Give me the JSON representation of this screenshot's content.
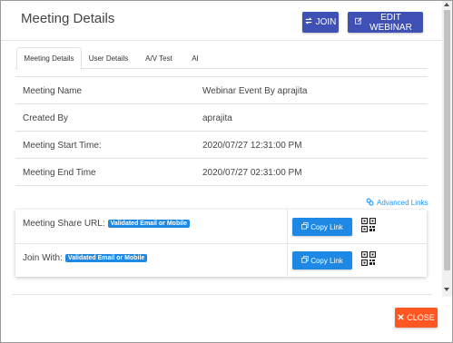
{
  "header": {
    "title": "Meeting Details",
    "join_label": "JOIN",
    "edit_label": "EDIT WEBINAR"
  },
  "tabs": [
    {
      "label": "Meeting Details",
      "active": true
    },
    {
      "label": "User Details",
      "active": false
    },
    {
      "label": "A/V Test",
      "active": false
    },
    {
      "label": "AI",
      "active": false
    }
  ],
  "details": [
    {
      "label": "Meeting Name",
      "value": "Webinar Event By aprajita"
    },
    {
      "label": "Created By",
      "value": "aprajita"
    },
    {
      "label": "Meeting Start Time:",
      "value": "2020/07/27 12:31:00 PM"
    },
    {
      "label": "Meeting End Time",
      "value": "2020/07/27 02:31:00 PM"
    }
  ],
  "advanced_links_label": "Advanced Links",
  "share": [
    {
      "label": "Meeting Share URL:",
      "badge": "Validated Email or Mobile",
      "button": "Copy Link"
    },
    {
      "label": "Join With:",
      "badge": "Validated Email or Mobile",
      "button": "Copy Link"
    }
  ],
  "footer": {
    "close_label": "CLOSE"
  },
  "colors": {
    "primary": "#3f51b5",
    "accent_blue": "#1e88e5",
    "close_orange": "#ff5722"
  }
}
